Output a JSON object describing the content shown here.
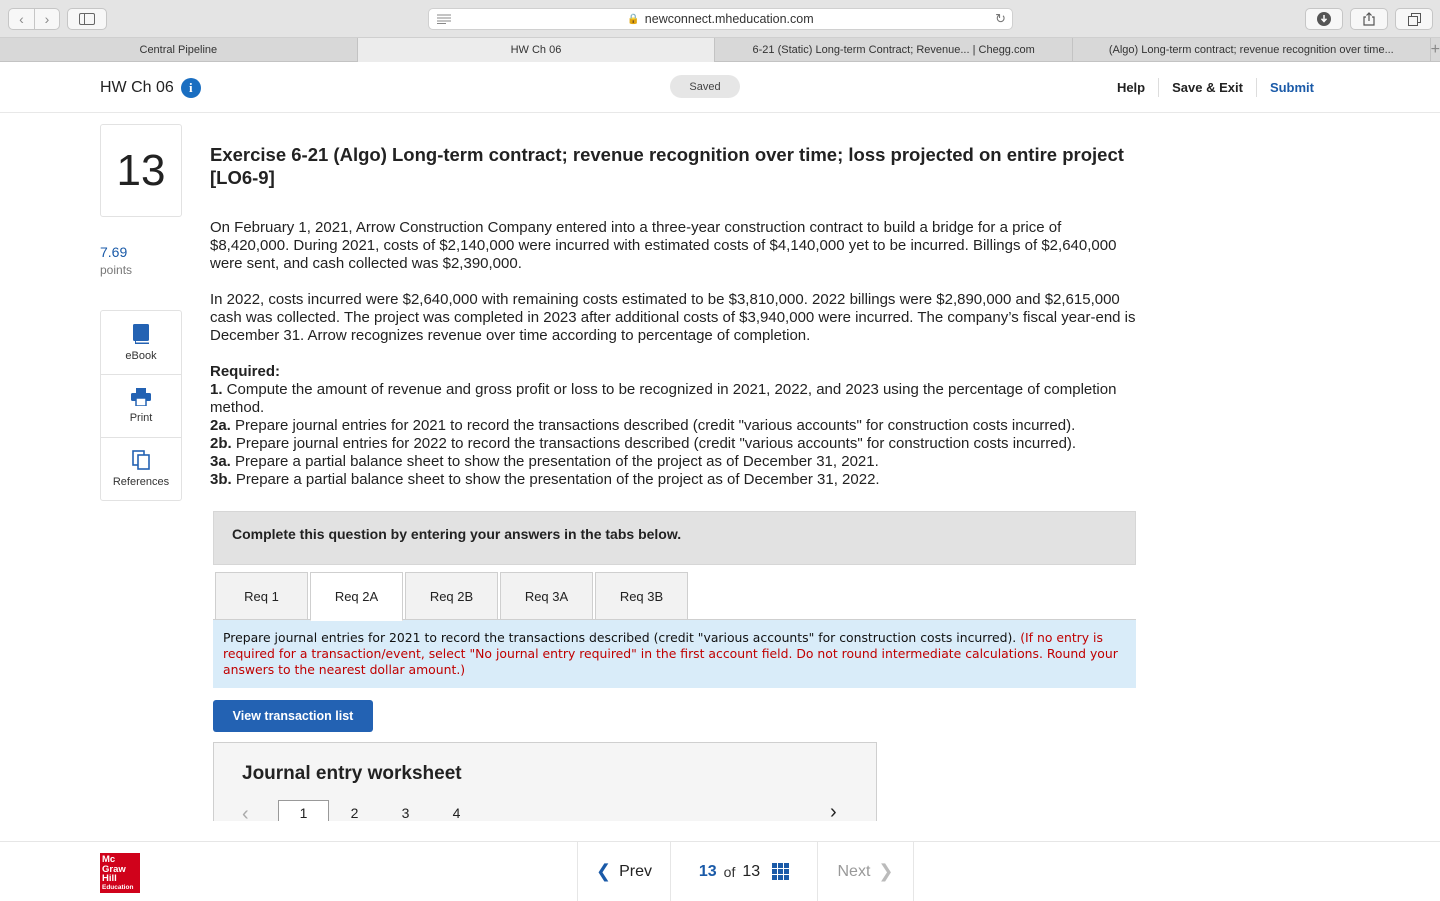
{
  "browser": {
    "url": "newconnect.mheducation.com",
    "tabs": [
      {
        "label": "Central Pipeline"
      },
      {
        "label": "HW Ch 06"
      },
      {
        "label": "6-21 (Static) Long-term Contract; Revenue... | Chegg.com"
      },
      {
        "label": "(Algo) Long-term contract; revenue recognition over time..."
      }
    ],
    "add_tab": "+"
  },
  "header": {
    "title": "HW Ch 06",
    "info": "i",
    "status": "Saved",
    "help": "Help",
    "save_exit": "Save & Exit",
    "submit": "Submit"
  },
  "rail": {
    "question_number": "13",
    "points_value": "7.69",
    "points_label": "points",
    "tools": [
      {
        "label": "eBook"
      },
      {
        "label": "Print"
      },
      {
        "label": "References"
      }
    ]
  },
  "question": {
    "title": "Exercise 6-21 (Algo) Long-term contract; revenue recognition over time; loss projected on entire project [LO6-9]",
    "para1": "On February 1, 2021, Arrow Construction Company entered into a three-year construction contract to build a bridge for a price of $8,420,000. During 2021, costs of $2,140,000 were incurred with estimated costs of $4,140,000 yet to be incurred. Billings of $2,640,000 were sent, and cash collected was $2,390,000.",
    "para2": "In 2022, costs incurred were $2,640,000 with remaining costs estimated to be $3,810,000. 2022 billings were $2,890,000 and $2,615,000 cash was collected. The project was completed in 2023 after additional costs of $3,940,000 were incurred. The company’s fiscal year-end is December 31. Arrow recognizes revenue over time according to percentage of completion.",
    "required_heading": "Required:",
    "requirements": [
      {
        "num": "1.",
        "text": " Compute the amount of revenue and gross profit or loss to be recognized in 2021, 2022, and 2023 using the percentage of completion method."
      },
      {
        "num": "2a.",
        "text": " Prepare journal entries for 2021 to record the transactions described (credit \"various accounts\" for construction costs incurred)."
      },
      {
        "num": "2b.",
        "text": " Prepare journal entries for 2022 to record the transactions described (credit \"various accounts\" for construction costs incurred)."
      },
      {
        "num": "3a.",
        "text": " Prepare a partial balance sheet to show the presentation of the project as of December 31, 2021."
      },
      {
        "num": "3b.",
        "text": " Prepare a partial balance sheet to show the presentation of the project as of December 31, 2022."
      }
    ]
  },
  "answer_area": {
    "prompt": "Complete this question by entering your answers in the tabs below.",
    "tabs": [
      {
        "label": "Req 1"
      },
      {
        "label": "Req 2A"
      },
      {
        "label": "Req 2B"
      },
      {
        "label": "Req 3A"
      },
      {
        "label": "Req 3B"
      }
    ],
    "active_tab": "Req 2A",
    "instruction": "Prepare journal entries for 2021 to record the transactions described (credit \"various accounts\" for construction costs incurred).",
    "instruction_note": "(If no entry is required for a transaction/event, select \"No journal entry required\" in the first account field. Do not round intermediate calculations. Round your answers to the nearest dollar amount.)",
    "view_button": "View transaction list",
    "worksheet_title": "Journal entry worksheet",
    "worksheet_pages": [
      "1",
      "2",
      "3",
      "4"
    ],
    "worksheet_current_page": "1"
  },
  "footer": {
    "logo_lines": [
      "Mc",
      "Graw",
      "Hill",
      "Education"
    ],
    "prev": "Prev",
    "current": "13",
    "of": "of",
    "total": "13",
    "next": "Next"
  },
  "colors": {
    "accent_blue": "#1a5aa8",
    "button_blue": "#2362b3",
    "instruction_bg": "#d9ecf9",
    "note_red": "#c00000",
    "logo_red": "#d0021b"
  }
}
